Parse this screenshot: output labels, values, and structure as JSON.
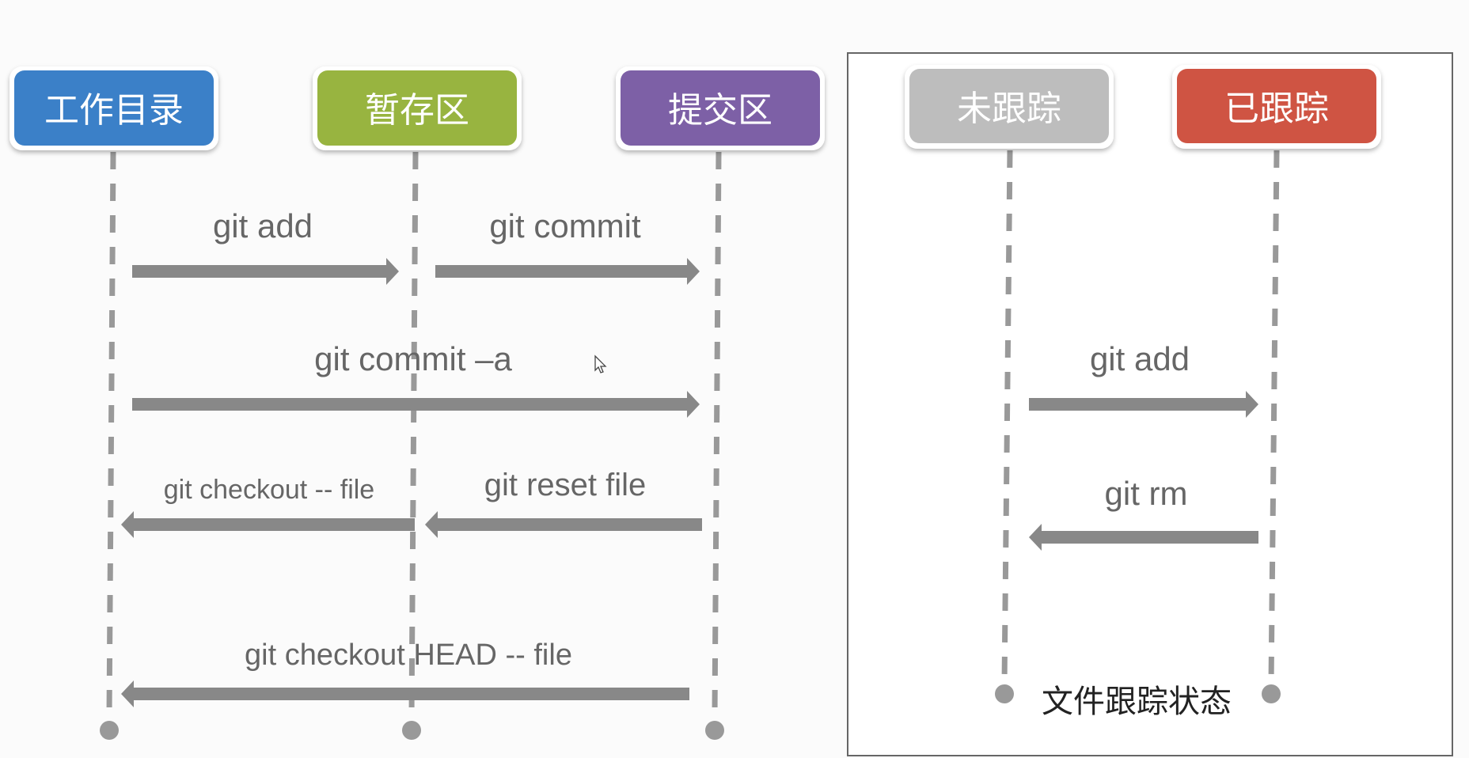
{
  "git_flow": {
    "stages": [
      {
        "label": "工作目录",
        "color": "#3b80c8"
      },
      {
        "label": "暂存区",
        "color": "#98b440"
      },
      {
        "label": "提交区",
        "color": "#7d60a6"
      }
    ],
    "commands": {
      "add": "git add",
      "commit": "git commit",
      "commit_all": "git commit –a",
      "checkout_file": "git checkout -- file",
      "reset_file": "git reset file",
      "checkout_head": "git checkout HEAD -- file"
    }
  },
  "file_tracking": {
    "states": [
      {
        "label": "未跟踪",
        "color": "#bdbdbd"
      },
      {
        "label": "已跟踪",
        "color": "#cf5443"
      }
    ],
    "commands": {
      "add": "git add",
      "rm": "git rm"
    },
    "caption": "文件跟踪状态"
  }
}
